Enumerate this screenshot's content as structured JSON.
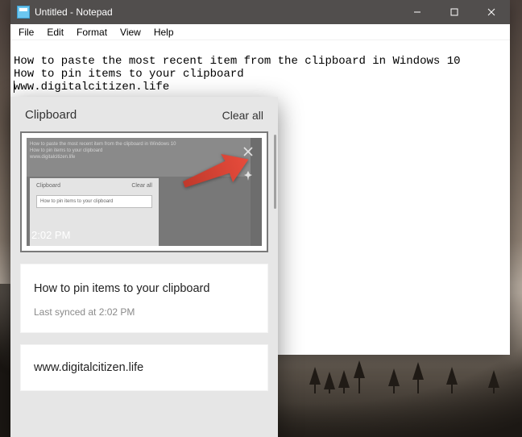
{
  "window": {
    "title": "Untitled - Notepad",
    "minimize": "–",
    "maximize": "❐",
    "close": "✕"
  },
  "menu": {
    "file": "File",
    "edit": "Edit",
    "format": "Format",
    "view": "View",
    "help": "Help"
  },
  "editor": {
    "line1": "How to paste the most recent item from the clipboard in Windows 10",
    "line2": "How to pin items to your clipboard",
    "line3": "www.digitalcitizen.life"
  },
  "clipboard": {
    "title": "Clipboard",
    "clear_all": "Clear all",
    "thumb": {
      "mini_line1": "How to paste the most recent item from the clipboard in Windows 10",
      "mini_line2": "How to pin items to your clipboard",
      "mini_line3": "www.digitalcitizen.life",
      "mini_panel_title": "Clipboard",
      "mini_panel_clear": "Clear all",
      "mini_item_text": "How to pin items to your clipboard",
      "timestamp": "2:02 PM"
    },
    "item2_text": "How to pin items to your clipboard",
    "item2_sync": "Last synced at 2:02 PM",
    "item3_text": "www.digitalcitizen.life"
  },
  "icons": {
    "delete": "delete-icon",
    "pin": "pin-icon"
  }
}
